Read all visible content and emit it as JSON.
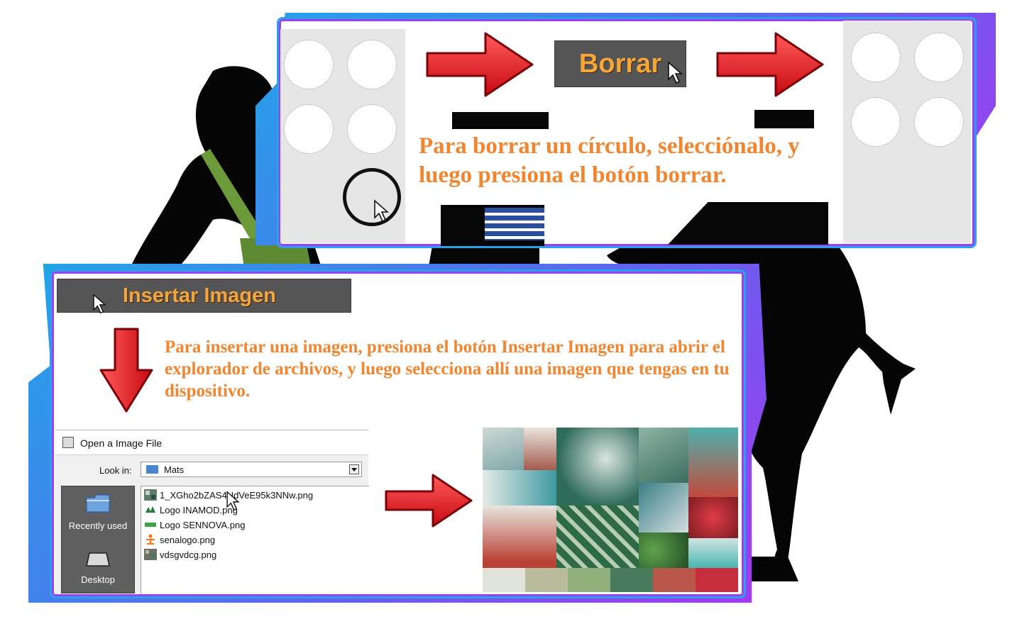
{
  "borrar_panel": {
    "button_label": "Borrar",
    "instruction": "Para borrar un círculo, selecciónalo, y luego presiona el botón borrar."
  },
  "insertar_panel": {
    "button_label": "Insertar Imagen",
    "instruction": "Para insertar una imagen, presiona el botón Insertar Imagen para abrir el explorador de archivos, y luego selecciona allí una imagen que tengas en tu dispositivo."
  },
  "file_dialog": {
    "title": "Open a Image File",
    "look_in_label": "Look in:",
    "look_in_value": "Mats",
    "places": [
      {
        "label": "Recently used",
        "icon": "folder-icon"
      },
      {
        "label": "Desktop",
        "icon": "desktop-icon"
      }
    ],
    "files": [
      {
        "name": "1_XGho2bZAS4UdVeE95k3NNw.png",
        "icon": "image-thumbnail-icon"
      },
      {
        "name": "Logo INAMOD.png",
        "icon": "logo-inamod-icon"
      },
      {
        "name": "Logo SENNOVA.png",
        "icon": "logo-sennova-icon"
      },
      {
        "name": "senalogo.png",
        "icon": "sena-logo-icon"
      },
      {
        "name": "vdsgvdcg.png",
        "icon": "image-thumbnail-icon"
      }
    ]
  },
  "colors": {
    "arrow_red": "#f0222a",
    "button_text_orange": "#f5a63a",
    "instruction_orange": "#f28630",
    "frame_blue": "#21a5e8",
    "frame_purple": "#a637f0"
  },
  "moodboard_palette": [
    "#dfe3da",
    "#b9bc9c",
    "#8fb07a",
    "#497a5c",
    "#b8574a",
    "#c62e3c"
  ]
}
